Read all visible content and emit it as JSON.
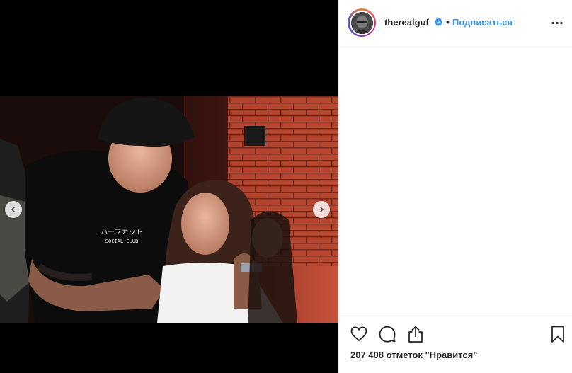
{
  "post": {
    "username": "therealguf",
    "follow_label": "Подписаться",
    "dot": "•",
    "likes_text": "207 408 отметок \"Нравится\""
  },
  "icons": {
    "verified": "verified-badge-icon",
    "more": "more-options-icon",
    "like": "heart-icon",
    "comment": "comment-icon",
    "share": "share-icon",
    "save": "bookmark-icon",
    "prev": "chevron-left-icon",
    "next": "chevron-right-icon"
  },
  "colors": {
    "accent": "#3897f0",
    "text": "#262626",
    "border": "#efefef"
  }
}
